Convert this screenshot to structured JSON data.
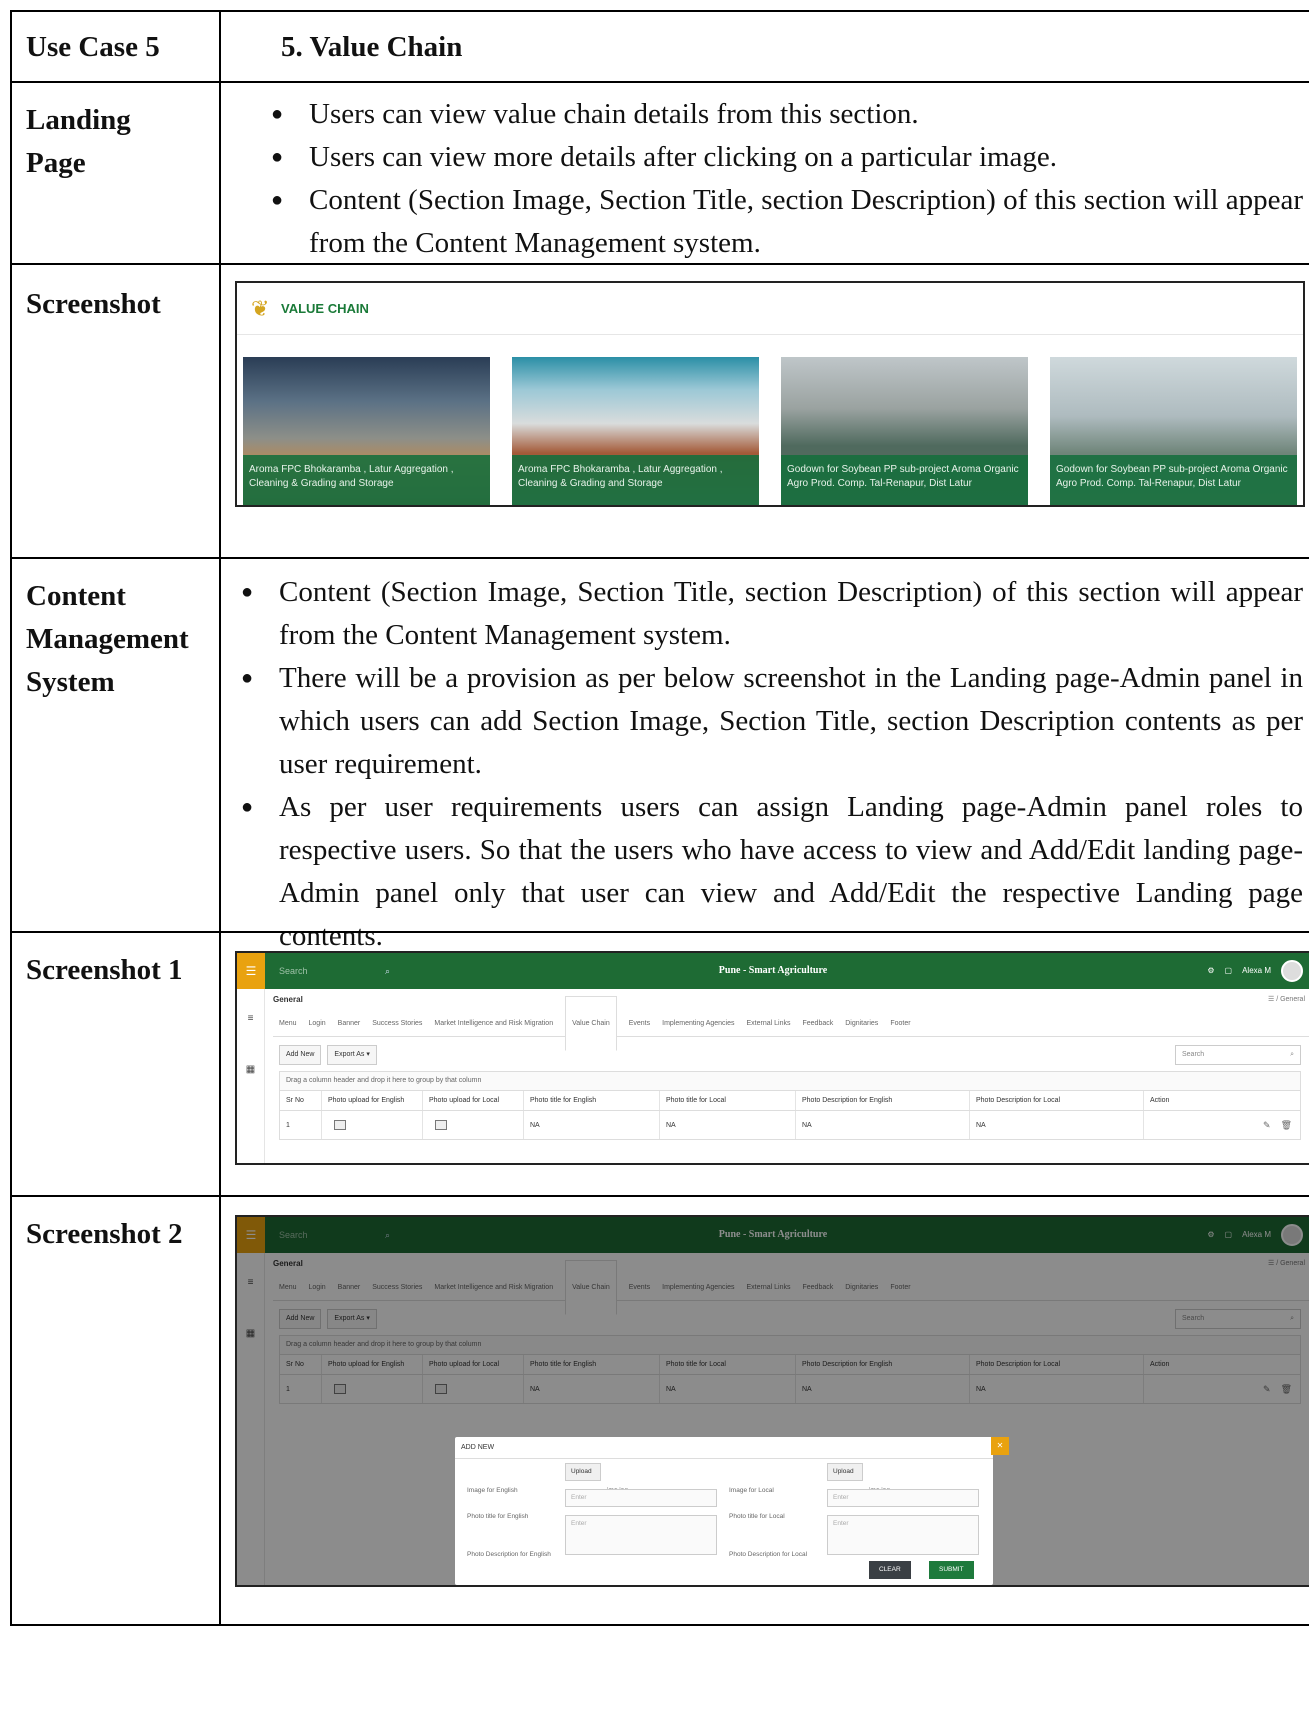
{
  "row_use_case": {
    "label": "Use Case 5",
    "title": "5.   Value Chain"
  },
  "row_landing": {
    "label_line1": "Landing",
    "label_line2": "Page",
    "bullets": [
      "Users can view value chain details from this section.",
      "Users can view more details after clicking on a particular image.",
      "Content (Section Image, Section Title, section Description) of this section will appear from the Content Management system."
    ]
  },
  "row_screenshot": {
    "label": "Screenshot",
    "section_title": "VALUE CHAIN",
    "cards": [
      "Aroma FPC Bhokaramba , Latur Aggregation , Cleaning & Grading and Storage",
      "Aroma FPC Bhokaramba , Latur Aggregation , Cleaning & Grading and Storage",
      "Godown for Soybean PP sub-project Aroma Organic Agro Prod. Comp. Tal-Renapur, Dist Latur",
      "Godown for Soybean PP sub-project Aroma Organic Agro Prod. Comp. Tal-Renapur, Dist Latur"
    ]
  },
  "row_cms": {
    "label_line1": "Content",
    "label_line2": "Management",
    "label_line3": "System",
    "bullets": [
      "Content (Section Image, Section Title, section Description) of this section will appear from the Content Management system.",
      "There will be a provision as per below screenshot in the Landing page-Admin panel in which users can add Section Image, Section Title, section Description contents as per user requirement.",
      "As per user requirements users can assign Landing page-Admin panel roles to respective users. So that the users who have access to view and Add/Edit landing page-Admin panel only that user can view and Add/Edit the respective Landing page contents."
    ]
  },
  "admin": {
    "search_placeholder": "Search",
    "brand": "Pune - Smart Agriculture",
    "user_name": "Alexa M",
    "page": "General",
    "crumb": "General",
    "tabs": [
      "Menu",
      "Login",
      "Banner",
      "Success Stories",
      "Market Intelligence and Risk Migration",
      "Value Chain",
      "Events",
      "Implementing Agencies",
      "External Links",
      "Feedback",
      "Dignitaries",
      "Footer"
    ],
    "active_tab": "Value Chain",
    "add_new": "Add New",
    "export_as": "Export As",
    "grid_search": "Search",
    "drag_hint": "Drag a column header and drop it here to group by that column",
    "columns": [
      "Sr No",
      "Photo upload for English",
      "Photo upload for Local",
      "Photo title for English",
      "Photo title for Local",
      "Photo Description for English",
      "Photo Description for Local",
      "Action"
    ],
    "row": {
      "sr": "1",
      "title_en": "NA",
      "title_local": "NA",
      "desc_en": "NA",
      "desc_local": "NA"
    }
  },
  "row_shot1": {
    "label": "Screenshot 1"
  },
  "row_shot2": {
    "label": "Screenshot 2"
  },
  "modal": {
    "title": "ADD NEW",
    "image_en_label": "Image for English",
    "image_local_label": "Image for Local",
    "upload": "Upload",
    "file_name": "img.jpg",
    "title_en_label": "Photo title for English",
    "title_local_label": "Photo title for Local",
    "desc_en_label": "Photo Description for English",
    "desc_local_label": "Photo Description for Local",
    "enter": "Enter",
    "clear": "CLEAR",
    "submit": "SUBMIT"
  }
}
